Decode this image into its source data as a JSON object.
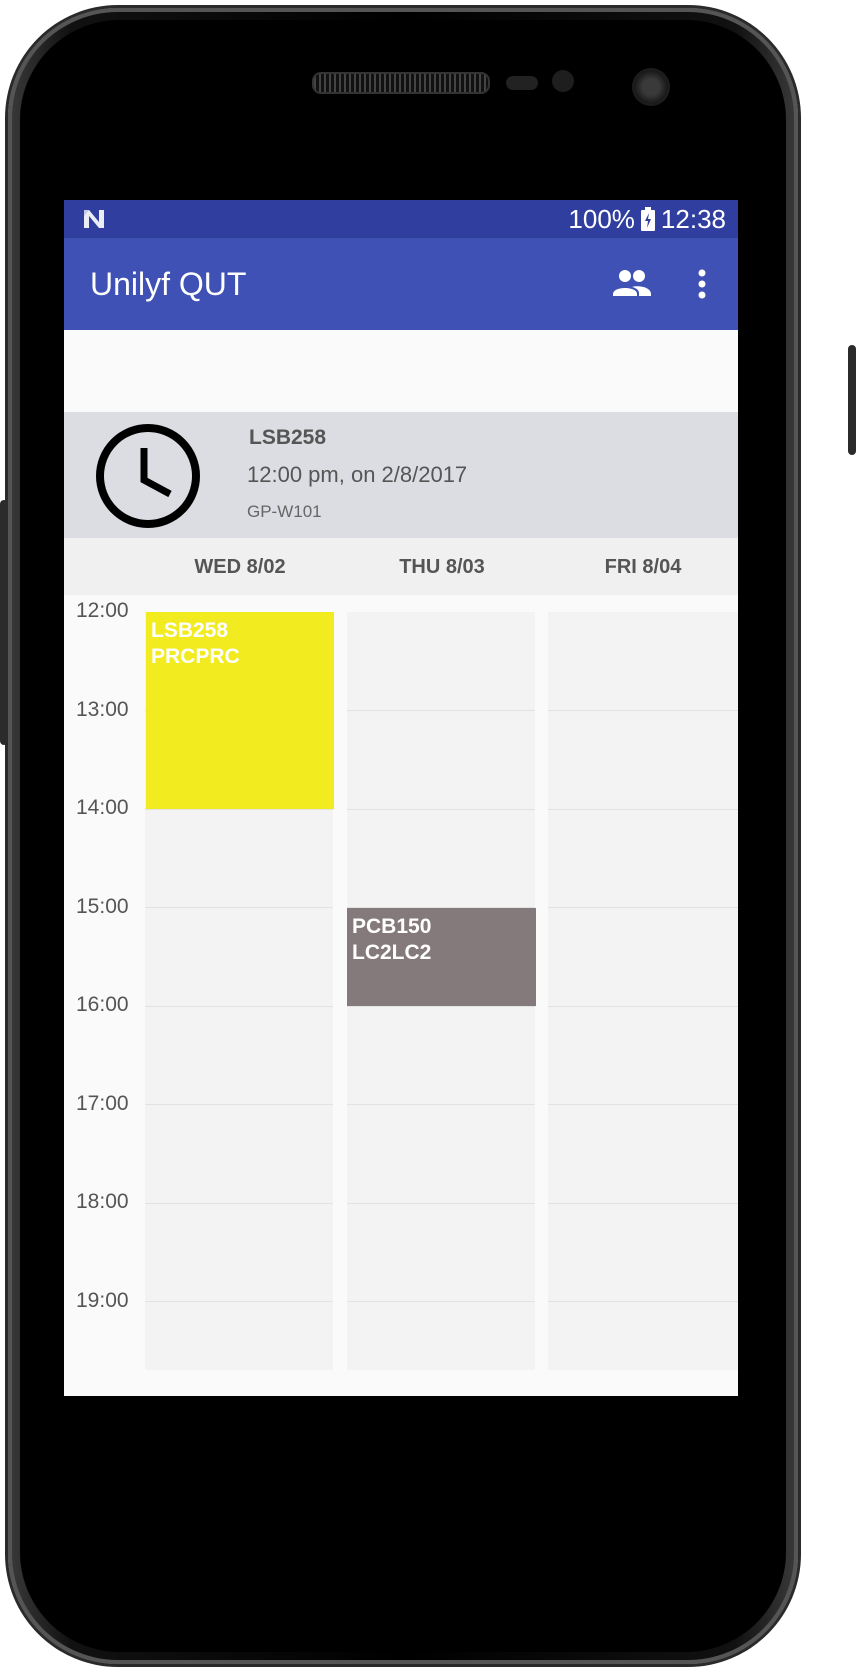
{
  "status_bar": {
    "battery": "100%",
    "time": "12:38",
    "icons": [
      "n-notification-icon",
      "battery-charging-icon"
    ]
  },
  "app_bar": {
    "title": "Unilyf QUT",
    "icons": [
      "people-icon",
      "more-vert-icon"
    ]
  },
  "info_card": {
    "icon": "clock-icon",
    "title": "LSB258",
    "time": "12:00 pm, on 2/8/2017",
    "room": "GP-W101"
  },
  "days": [
    {
      "label": "WED 8/02"
    },
    {
      "label": "THU 8/03"
    },
    {
      "label": "FRI 8/04"
    }
  ],
  "times": [
    "12:00",
    "13:00",
    "14:00",
    "15:00",
    "16:00",
    "17:00",
    "18:00",
    "19:00"
  ],
  "events": [
    {
      "line1": "LSB258",
      "line2": "PRCPRC",
      "color": "#f2eb1f"
    },
    {
      "line1": "PCB150",
      "line2": "LC2LC2",
      "color": "#857a7b"
    }
  ],
  "colors": {
    "status_bar": "#303f9f",
    "app_bar": "#3f51b5",
    "info_card": "#dcdde3"
  }
}
